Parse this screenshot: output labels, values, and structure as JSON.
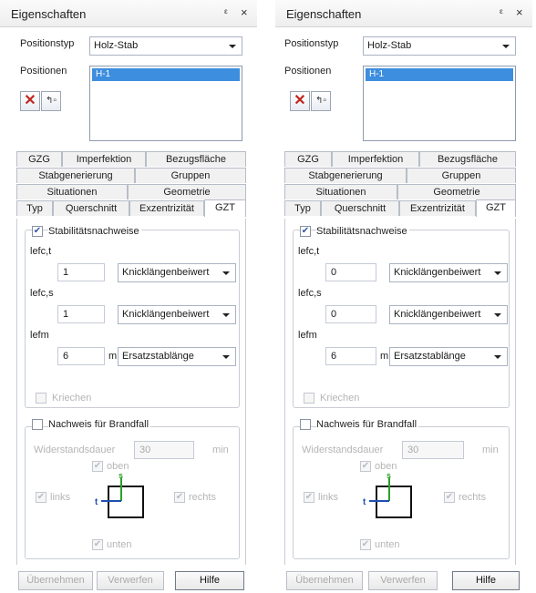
{
  "colors": {
    "selection": "#3d8ede",
    "delete_icon": "#c0261f",
    "axis_s": "#2aa02a",
    "axis_t": "#1f4fb5"
  },
  "panels": [
    {
      "title": "Eigenschaften",
      "pin": "ᵖ",
      "close": "×",
      "positionstyp_label": "Positionstyp",
      "positionstyp_value": "Holz-Stab",
      "positionen_label": "Positionen",
      "positionen_items": [
        "H-1"
      ],
      "tabs_row1": [
        "GZG",
        "Imperfektion",
        "Bezugsfläche"
      ],
      "tabs_row2": [
        "Stabgenerierung",
        "Gruppen"
      ],
      "tabs_row3": [
        "Situationen",
        "Geometrie"
      ],
      "tabs_row4": [
        "Typ",
        "Querschnitt",
        "Exzentrizität",
        "GZT"
      ],
      "stab_label": "Stabilitätsnachweise",
      "lefct_label": "lefc,t",
      "lefct_value": "1",
      "lefct_type": "Knicklängenbeiwert",
      "lefcs_label": "lefc,s",
      "lefcs_value": "1",
      "lefcs_type": "Knicklängenbeiwert",
      "lefm_label": "lefm",
      "lefm_value": "6",
      "lefm_unit": "m",
      "lefm_type": "Ersatzstablänge",
      "kriechen_label": "Kriechen",
      "brand_label": "Nachweis für Brandfall",
      "widerstand_label": "Widerstandsdauer",
      "widerstand_value": "30",
      "widerstand_unit": "min",
      "oben_label": "oben",
      "links_label": "links",
      "rechts_label": "rechts",
      "unten_label": "unten",
      "axis_s": "s",
      "axis_t": "t",
      "btn_apply": "Übernehmen",
      "btn_discard": "Verwerfen",
      "btn_help": "Hilfe"
    },
    {
      "title": "Eigenschaften",
      "pin": "ᵖ",
      "close": "×",
      "positionstyp_label": "Positionstyp",
      "positionstyp_value": "Holz-Stab",
      "positionen_label": "Positionen",
      "positionen_items": [
        "H-1"
      ],
      "tabs_row1": [
        "GZG",
        "Imperfektion",
        "Bezugsfläche"
      ],
      "tabs_row2": [
        "Stabgenerierung",
        "Gruppen"
      ],
      "tabs_row3": [
        "Situationen",
        "Geometrie"
      ],
      "tabs_row4": [
        "Typ",
        "Querschnitt",
        "Exzentrizität",
        "GZT"
      ],
      "stab_label": "Stabilitätsnachweise",
      "lefct_label": "lefc,t",
      "lefct_value": "0",
      "lefct_type": "Knicklängenbeiwert",
      "lefcs_label": "lefc,s",
      "lefcs_value": "0",
      "lefcs_type": "Knicklängenbeiwert",
      "lefm_label": "lefm",
      "lefm_value": "6",
      "lefm_unit": "m",
      "lefm_type": "Ersatzstablänge",
      "kriechen_label": "Kriechen",
      "brand_label": "Nachweis für Brandfall",
      "widerstand_label": "Widerstandsdauer",
      "widerstand_value": "30",
      "widerstand_unit": "min",
      "oben_label": "oben",
      "links_label": "links",
      "rechts_label": "rechts",
      "unten_label": "unten",
      "axis_s": "s",
      "axis_t": "t",
      "btn_apply": "Übernehmen",
      "btn_discard": "Verwerfen",
      "btn_help": "Hilfe"
    }
  ]
}
